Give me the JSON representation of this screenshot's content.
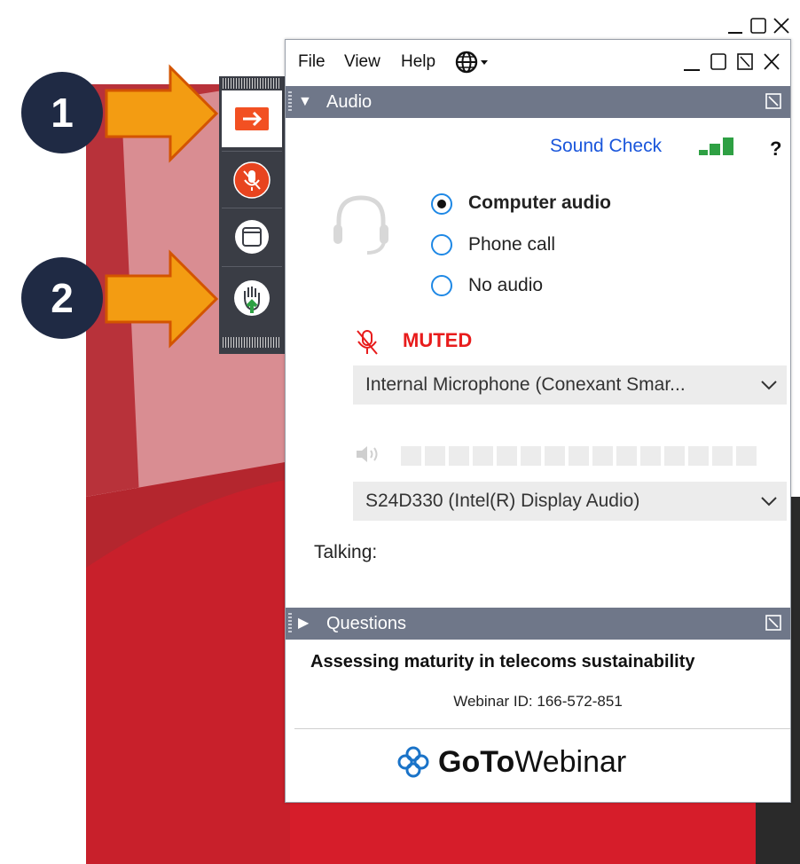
{
  "outer_window": {
    "minimize_icon": "minimize-icon",
    "maximize_icon": "maximize-icon",
    "close_icon": "close-icon"
  },
  "control_panel": {
    "buttons": [
      {
        "name": "expand-panel-button",
        "icon": "arrow-right-icon",
        "color": "#f25022",
        "active": true
      },
      {
        "name": "microphone-toggle-button",
        "icon": "microphone-muted-icon",
        "color": "#e8441f"
      },
      {
        "name": "screen-view-button",
        "icon": "window-icon",
        "color": "#ffffff"
      },
      {
        "name": "raise-hand-button",
        "icon": "hand-raise-icon",
        "color": "#2ea043"
      }
    ]
  },
  "callouts": [
    {
      "number": "1"
    },
    {
      "number": "2"
    }
  ],
  "menubar": {
    "file": "File",
    "view": "View",
    "help": "Help",
    "language_icon": "globe-icon"
  },
  "audio": {
    "header": "Audio",
    "sound_check": "Sound Check",
    "help_mark": "?",
    "options": [
      {
        "label": "Computer audio",
        "selected": true
      },
      {
        "label": "Phone call",
        "selected": false
      },
      {
        "label": "No audio",
        "selected": false
      }
    ],
    "muted_label": "MUTED",
    "microphone_select": "Internal Microphone (Conexant Smar...",
    "speaker_select": "S24D330 (Intel(R) Display Audio)",
    "talking_label": "Talking:",
    "speaker_level": 0,
    "colors": {
      "link": "#1a56db",
      "muted": "#e81c1c",
      "signal": "#2ea043"
    }
  },
  "questions": {
    "header": "Questions"
  },
  "webinar": {
    "title": "Assessing maturity in telecoms sustainability",
    "id_line": "Webinar ID: 166-572-851",
    "brand_bold": "GoTo",
    "brand_light": "Webinar",
    "brand_color": "#1a73c8"
  }
}
